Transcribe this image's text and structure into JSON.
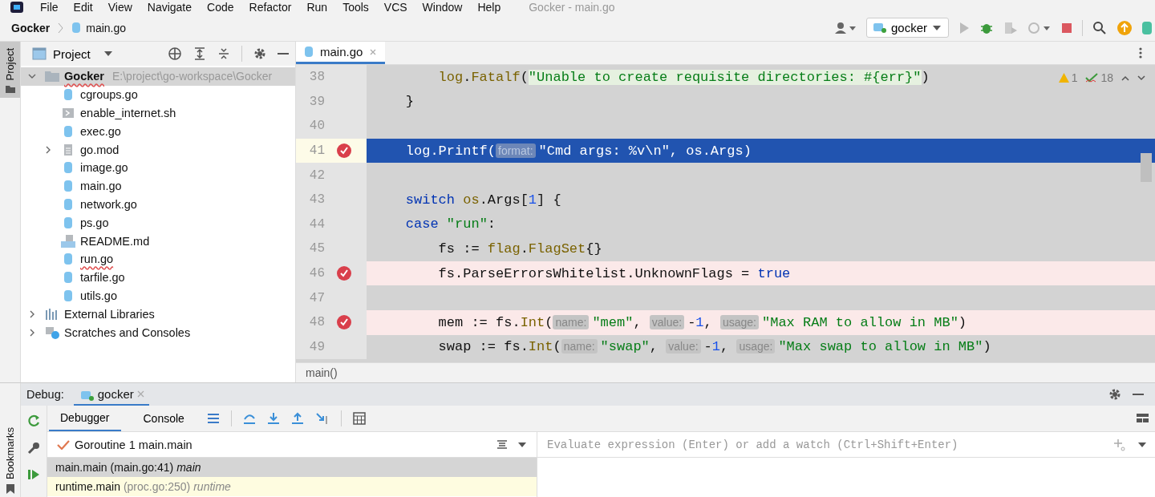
{
  "menu": [
    "File",
    "Edit",
    "View",
    "Navigate",
    "Code",
    "Refactor",
    "Run",
    "Tools",
    "VCS",
    "Window",
    "Help"
  ],
  "window": {
    "title": "Gocker - main.go"
  },
  "breadcrumbs": [
    "Gocker",
    "main.go"
  ],
  "run_config": {
    "label": "gocker"
  },
  "project_panel": {
    "title": "Project",
    "side_tab": "Project",
    "root": {
      "name": "Gocker",
      "path": "E:\\project\\go-workspace\\Gocker",
      "expanded": true,
      "selected": true,
      "error": true,
      "children": [
        {
          "name": "cgroups.go",
          "kind": "go",
          "selected": false,
          "error": false
        },
        {
          "name": "enable_internet.sh",
          "kind": "shell",
          "selected": false,
          "error": false
        },
        {
          "name": "exec.go",
          "kind": "go",
          "selected": false,
          "error": false
        },
        {
          "name": "go.mod",
          "kind": "mod",
          "expanded": false,
          "selected": false,
          "error": false
        },
        {
          "name": "image.go",
          "kind": "go",
          "selected": false,
          "error": false
        },
        {
          "name": "main.go",
          "kind": "go",
          "selected": false,
          "error": false
        },
        {
          "name": "network.go",
          "kind": "go",
          "selected": false,
          "error": false
        },
        {
          "name": "ps.go",
          "kind": "go",
          "selected": false,
          "error": false
        },
        {
          "name": "README.md",
          "kind": "md",
          "selected": false,
          "error": false
        },
        {
          "name": "run.go",
          "kind": "go",
          "selected": false,
          "error": true
        },
        {
          "name": "tarfile.go",
          "kind": "go",
          "selected": false,
          "error": false
        },
        {
          "name": "utils.go",
          "kind": "go",
          "selected": false,
          "error": false
        }
      ]
    },
    "others": [
      {
        "name": "External Libraries",
        "kind": "libs",
        "expanded": false,
        "selected": false
      },
      {
        "name": "Scratches and Consoles",
        "kind": "scratch",
        "expanded": false,
        "selected": false
      }
    ]
  },
  "editor": {
    "tab": {
      "label": "main.go",
      "selected": true
    },
    "inspections": {
      "warnings": "1",
      "passed": "18"
    },
    "lines": [
      {
        "number": "38",
        "breakpoint": false,
        "current": false,
        "tokens": [
          {
            "text": "        log",
            "kind": "pkg"
          },
          {
            "text": ".",
            "kind": "plain"
          },
          {
            "text": "Fatalf",
            "kind": "pkg"
          },
          {
            "text": "(",
            "kind": "plain"
          },
          {
            "text": "\"Unable to create requisite directories: #{err}\"",
            "kind": "highlighted"
          },
          {
            "text": ")",
            "kind": "plain"
          }
        ]
      },
      {
        "number": "39",
        "breakpoint": false,
        "current": false,
        "tokens": [
          {
            "text": "    }",
            "kind": "plain"
          }
        ]
      },
      {
        "number": "40",
        "breakpoint": false,
        "current": false
      },
      {
        "number": "41",
        "breakpoint": true,
        "current": true,
        "tokens": [
          {
            "text": "    log.Printf(",
            "kind": "plain"
          },
          {
            "text": "format:",
            "kind": "hint"
          },
          {
            "text": "\"Cmd args: %v\\n\", os.Args)",
            "kind": "plain"
          }
        ]
      },
      {
        "number": "42",
        "breakpoint": false,
        "current": false
      },
      {
        "number": "43",
        "breakpoint": false,
        "current": false,
        "tokens": [
          {
            "text": "    switch",
            "kind": "keyword"
          },
          {
            "text": " os",
            "kind": "pkg"
          },
          {
            "text": ".Args[",
            "kind": "plain"
          },
          {
            "text": "1",
            "kind": "number"
          },
          {
            "text": "] {",
            "kind": "plain"
          }
        ]
      },
      {
        "number": "44",
        "breakpoint": false,
        "current": false,
        "tokens": [
          {
            "text": "    case",
            "kind": "keyword"
          },
          {
            "text": " \"run\"",
            "kind": "string"
          },
          {
            "text": ":",
            "kind": "plain"
          }
        ]
      },
      {
        "number": "45",
        "breakpoint": false,
        "current": false,
        "tokens": [
          {
            "text": "        fs := ",
            "kind": "plain"
          },
          {
            "text": "flag",
            "kind": "pkg"
          },
          {
            "text": ".",
            "kind": "plain"
          },
          {
            "text": "FlagSet",
            "kind": "pkg"
          },
          {
            "text": "{}",
            "kind": "plain"
          }
        ]
      },
      {
        "number": "46",
        "breakpoint": true,
        "current": false,
        "tokens": [
          {
            "text": "        fs.ParseErrorsWhitelist.UnknownFlags = ",
            "kind": "plain"
          },
          {
            "text": "true",
            "kind": "keyword"
          }
        ]
      },
      {
        "number": "47",
        "breakpoint": false,
        "current": false
      },
      {
        "number": "48",
        "breakpoint": true,
        "current": false,
        "tokens": [
          {
            "text": "        mem := fs.",
            "kind": "plain"
          },
          {
            "text": "Int",
            "kind": "pkg"
          },
          {
            "text": "(",
            "kind": "plain"
          },
          {
            "text": "name:",
            "kind": "hint"
          },
          {
            "text": "\"mem\"",
            "kind": "string"
          },
          {
            "text": ", ",
            "kind": "plain"
          },
          {
            "text": "value:",
            "kind": "hint"
          },
          {
            "text": "-",
            "kind": "plain"
          },
          {
            "text": "1",
            "kind": "number"
          },
          {
            "text": ", ",
            "kind": "plain"
          },
          {
            "text": "usage:",
            "kind": "hint"
          },
          {
            "text": "\"Max RAM to allow in MB\"",
            "kind": "string"
          },
          {
            "text": ")",
            "kind": "plain"
          }
        ]
      },
      {
        "number": "49",
        "breakpoint": false,
        "current": false,
        "tokens": [
          {
            "text": "        swap := fs.",
            "kind": "plain"
          },
          {
            "text": "Int",
            "kind": "pkg"
          },
          {
            "text": "(",
            "kind": "plain"
          },
          {
            "text": "name:",
            "kind": "hint"
          },
          {
            "text": "\"swap\"",
            "kind": "string"
          },
          {
            "text": ", ",
            "kind": "plain"
          },
          {
            "text": "value:",
            "kind": "hint"
          },
          {
            "text": "-",
            "kind": "plain"
          },
          {
            "text": "1",
            "kind": "number"
          },
          {
            "text": ", ",
            "kind": "plain"
          },
          {
            "text": "usage:",
            "kind": "hint"
          },
          {
            "text": "\"Max swap to allow in MB\"",
            "kind": "string"
          },
          {
            "text": ")",
            "kind": "plain"
          }
        ]
      }
    ],
    "breadcrumb": "main()"
  },
  "debug": {
    "label": "Debug:",
    "session": "gocker",
    "side_tab": "Bookmarks",
    "tabs": [
      {
        "label": "Debugger",
        "selected": true
      },
      {
        "label": "Console",
        "selected": false
      }
    ],
    "thread": "Goroutine 1 main.main",
    "watch": {
      "placeholder": "Evaluate expression (Enter) or add a watch (Ctrl+Shift+Enter)"
    },
    "frames": [
      {
        "name": "main.main",
        "location": "(main.go:41)",
        "package": "main",
        "selected": true
      },
      {
        "name": "runtime.main",
        "location": "(proc.go:250)",
        "package": "runtime",
        "selected": false
      }
    ]
  }
}
